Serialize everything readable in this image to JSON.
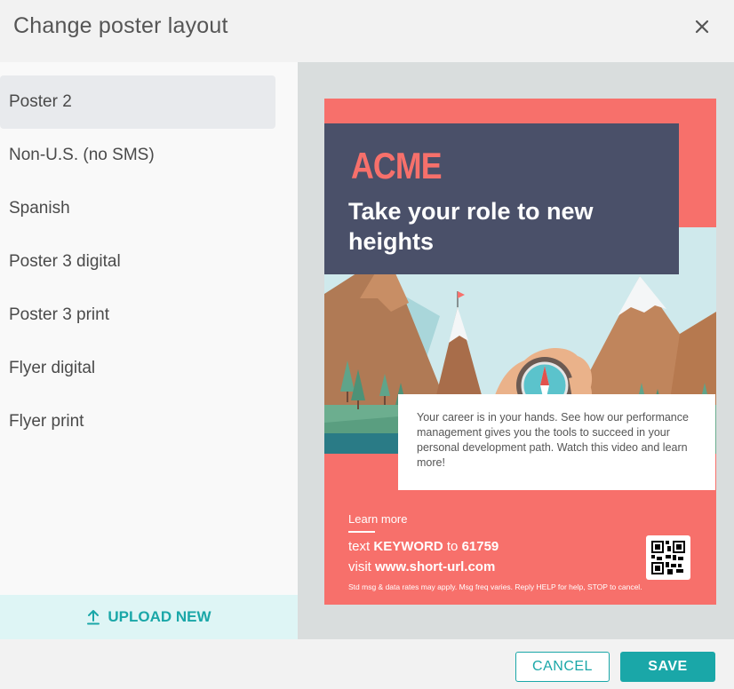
{
  "dialog": {
    "title": "Change poster layout",
    "close_icon": "close-icon"
  },
  "sidebar": {
    "selected_index": 0,
    "items": [
      {
        "label": "Poster 2"
      },
      {
        "label": "Non-U.S. (no SMS)"
      },
      {
        "label": "Spanish"
      },
      {
        "label": "Poster 3 digital"
      },
      {
        "label": "Poster 3 print"
      },
      {
        "label": "Flyer digital"
      },
      {
        "label": "Flyer print"
      }
    ],
    "upload_label": "UPLOAD NEW",
    "upload_icon": "upload-icon"
  },
  "poster": {
    "brand": "ACME",
    "headline": "Take your role to new heights",
    "body": "Your career is in your hands. See how our performance management gives you the tools to succeed in your personal development path. Watch this video and learn more!",
    "learn_more": "Learn more",
    "sms_prefix": "text ",
    "sms_keyword": "KEYWORD",
    "sms_mid": " to ",
    "sms_number": "61759",
    "visit_prefix": "visit ",
    "visit_url": "www.short-url.com",
    "fine_print": "Std msg & data rates may apply. Msg freq varies. Reply HELP for help, STOP to cancel.",
    "colors": {
      "coral": "#f7706b",
      "navy": "#4a5069",
      "sky": "#cfe9ec"
    }
  },
  "footer": {
    "cancel_label": "CANCEL",
    "save_label": "SAVE",
    "accent": "#1aa7a8"
  }
}
